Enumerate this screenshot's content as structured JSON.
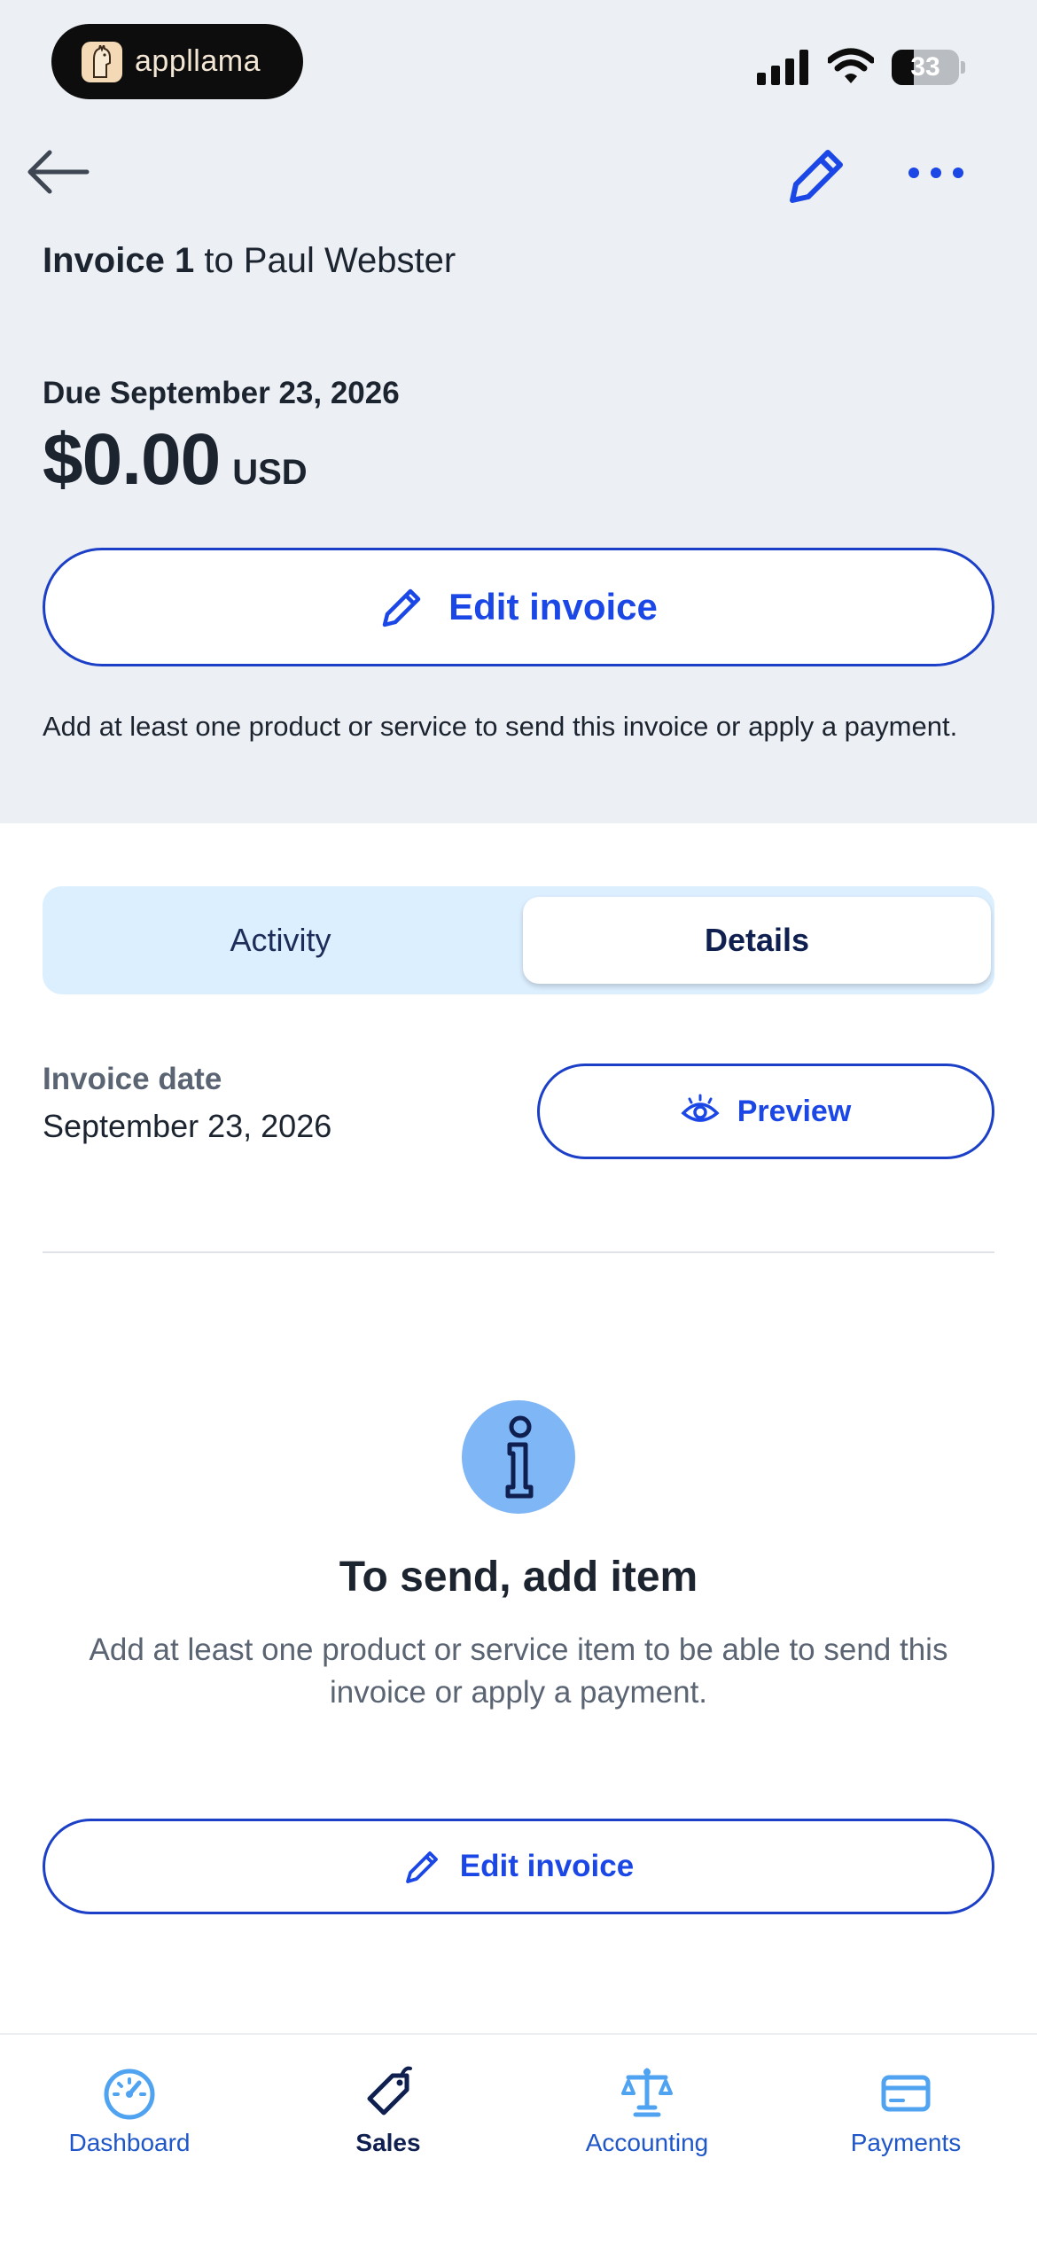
{
  "status_bar": {
    "app_badge": "appllama",
    "battery_level": "33"
  },
  "header": {
    "back_icon": "arrow-left-icon",
    "edit_icon": "pencil-icon",
    "more_icon": "more-horizontal-icon",
    "invoice_label": "Invoice 1",
    "invoice_to": "to Paul Webster"
  },
  "summary": {
    "due": "Due September 23, 2026",
    "amount": "$0.00",
    "currency": "USD",
    "edit_button": "Edit invoice",
    "hint": "Add at least one product or service to send this invoice or apply a payment."
  },
  "tabs": {
    "activity": "Activity",
    "details": "Details",
    "selected": "Details"
  },
  "details": {
    "invoice_date_label": "Invoice date",
    "invoice_date_value": "September 23, 2026",
    "preview_button": "Preview"
  },
  "empty_state": {
    "icon": "info-icon",
    "title": "To send, add item",
    "description": "Add at least one product or service item to be able to send this invoice or apply a payment.",
    "edit_button": "Edit invoice"
  },
  "bottom_nav": {
    "items": [
      {
        "label": "Dashboard",
        "icon": "gauge-icon"
      },
      {
        "label": "Sales",
        "icon": "tag-icon",
        "active": true
      },
      {
        "label": "Accounting",
        "icon": "scale-icon"
      },
      {
        "label": "Payments",
        "icon": "card-icon"
      }
    ]
  },
  "colors": {
    "accent": "#1a47e6",
    "header_bg": "#eceff3",
    "tab_bg": "#dcefff",
    "info_circle": "#7fb6f5",
    "text_dark": "#1c2430",
    "text_muted": "#5a6472"
  }
}
